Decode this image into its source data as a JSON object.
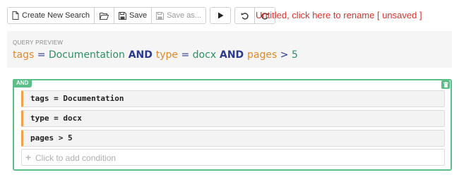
{
  "toolbar": {
    "create_label": "Create New Search",
    "open_icon": "folder-open-icon",
    "save_label": "Save",
    "save_as_label": "Save as...",
    "run_icon": "play-icon",
    "undo_icon": "undo-icon",
    "redo_icon": "redo-icon"
  },
  "document": {
    "title": "Untitled, click here to rename [ unsaved ]"
  },
  "preview": {
    "label": "QUERY PREVIEW",
    "tokens": [
      {
        "text": "tags",
        "kind": "field"
      },
      {
        "text": " = ",
        "kind": "op"
      },
      {
        "text": "Documentation",
        "kind": "val"
      },
      {
        "text": " AND ",
        "kind": "kw"
      },
      {
        "text": "type",
        "kind": "field"
      },
      {
        "text": " = ",
        "kind": "op"
      },
      {
        "text": "docx",
        "kind": "val"
      },
      {
        "text": " AND ",
        "kind": "kw"
      },
      {
        "text": "pages",
        "kind": "field"
      },
      {
        "text": " > ",
        "kind": "op"
      },
      {
        "text": "5",
        "kind": "val"
      }
    ]
  },
  "group": {
    "operator": "AND",
    "conditions": [
      {
        "text": "tags = Documentation"
      },
      {
        "text": "type = docx"
      },
      {
        "text": "pages > 5"
      }
    ],
    "add_placeholder": "Click to add condition"
  },
  "colors": {
    "title_red": "#d9342b",
    "group_green": "#5cbf8a",
    "condition_orange": "#f0a046",
    "field": "#e08a2a",
    "value": "#2f8f63",
    "keyword": "#2b3a8c"
  }
}
